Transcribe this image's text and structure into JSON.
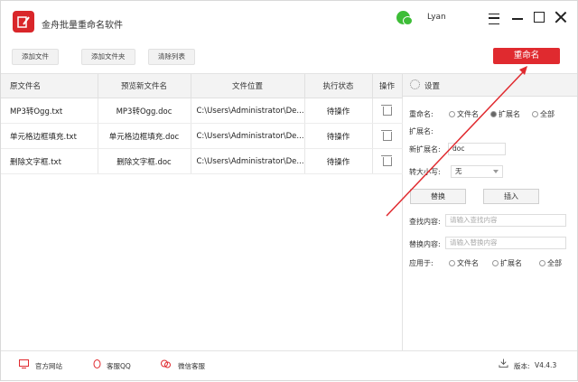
{
  "app": {
    "title": "金舟批量重命名软件",
    "user": "Lyan"
  },
  "toolbar": {
    "add_file": "添加文件",
    "add_folder": "添加文件夹",
    "clear_list": "清除列表",
    "rename": "重命名"
  },
  "table": {
    "headers": [
      "原文件名",
      "预览新文件名",
      "文件位置",
      "执行状态",
      "操作"
    ],
    "rows": [
      {
        "original": "MP3转Ogg.txt",
        "preview": "MP3转Ogg.doc",
        "location": "C:\\Users\\Administrator\\De...",
        "status": "待操作"
      },
      {
        "original": "单元格边框填充.txt",
        "preview": "单元格边框填充.doc",
        "location": "C:\\Users\\Administrator\\De...",
        "status": "待操作"
      },
      {
        "original": "删除文字框.txt",
        "preview": "删除文字框.doc",
        "location": "C:\\Users\\Administrator\\De...",
        "status": "待操作"
      }
    ]
  },
  "settings": {
    "title": "设置",
    "rename_label": "重命名:",
    "rename_options": [
      "文件名",
      "扩展名",
      "全部"
    ],
    "rename_selected": "扩展名",
    "ext_label": "扩展名:",
    "new_ext_label": "新扩展名:",
    "new_ext_value": "doc",
    "case_label": "转大小写:",
    "case_value": "无",
    "replace_button": "替换",
    "insert_button": "插入",
    "find_label": "查找内容:",
    "find_placeholder": "请输入查找内容",
    "replace_label": "替换内容:",
    "replace_placeholder": "请输入替换内容",
    "apply_label": "应用于:",
    "apply_options": [
      "文件名",
      "扩展名",
      "全部"
    ],
    "apply_selected": "全部"
  },
  "status": {
    "website": "官方网站",
    "qq": "客服QQ",
    "wechat": "微信客服",
    "version_label": "版本:",
    "version": "V4.4.3"
  },
  "colors": {
    "accent": "#e02a2f",
    "wechat": "#3dbd37"
  }
}
